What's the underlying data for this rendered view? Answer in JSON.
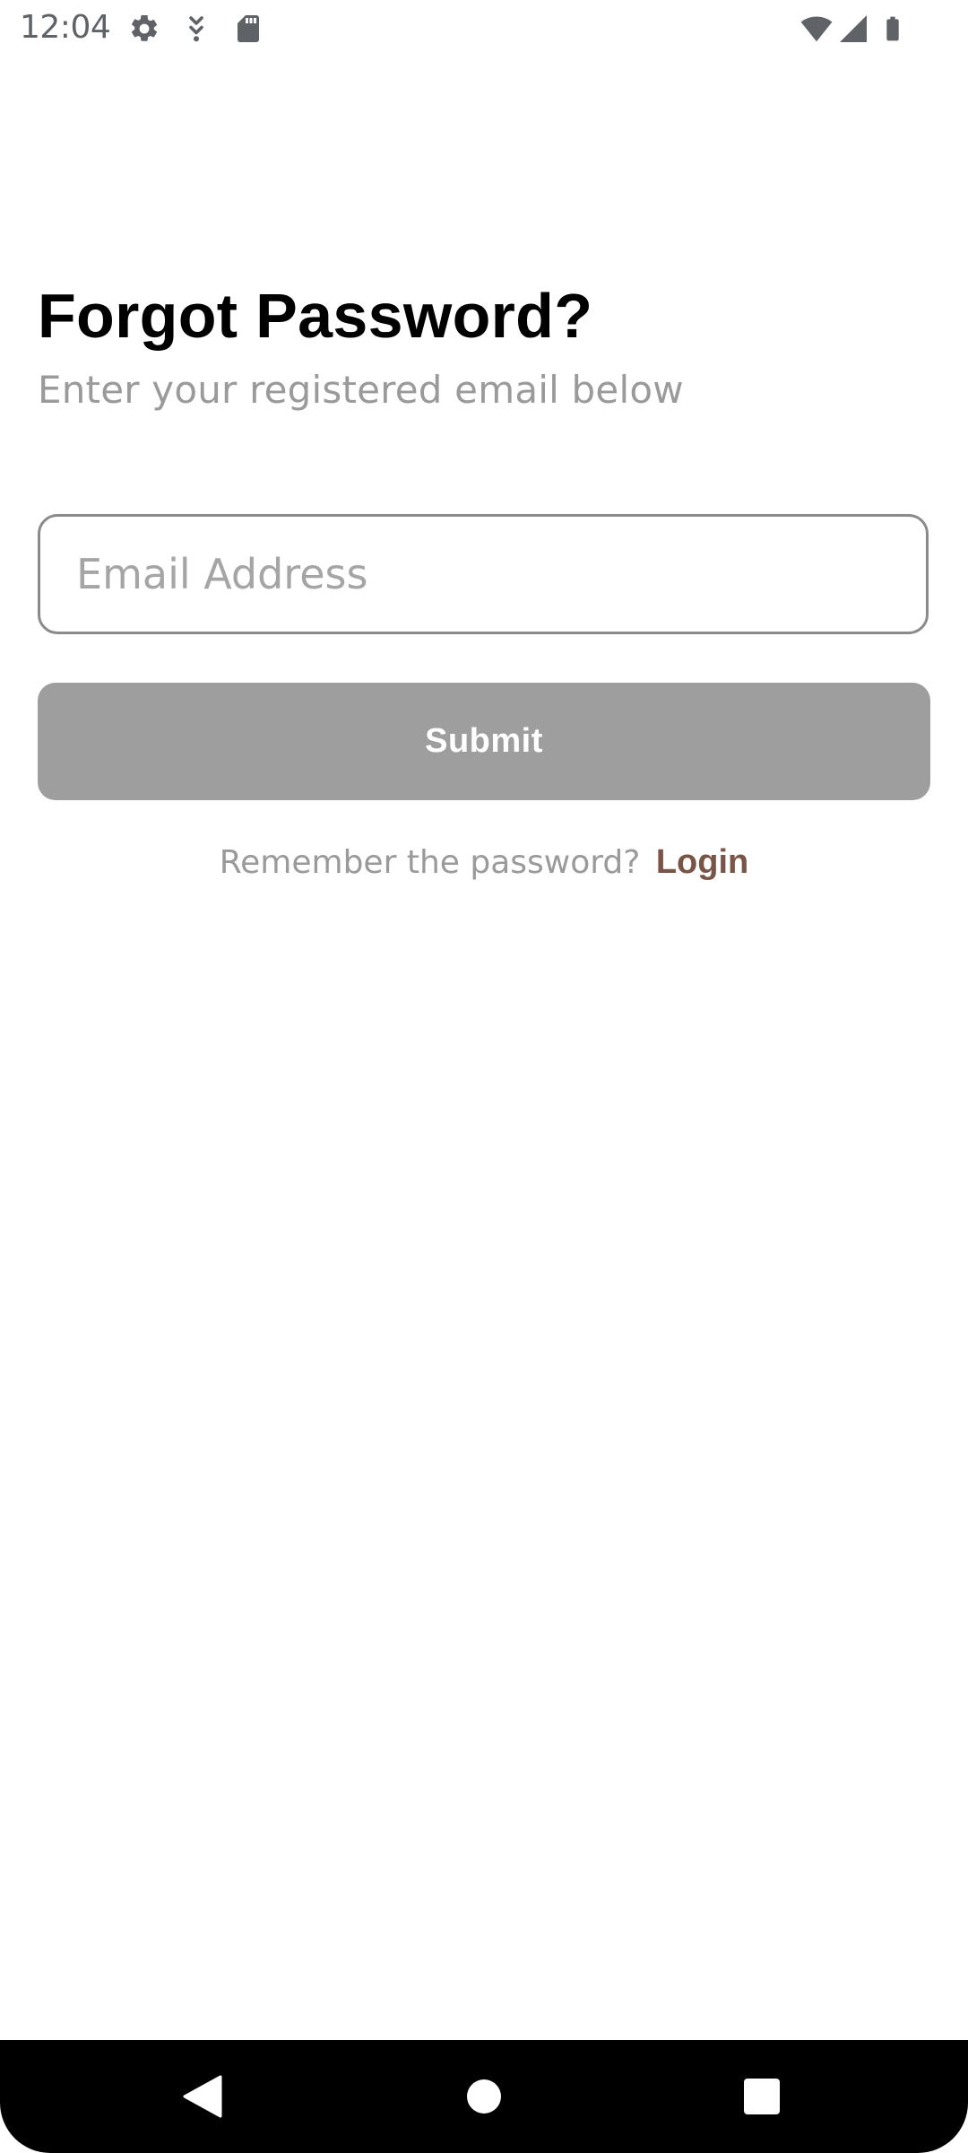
{
  "status_bar": {
    "time": "12:04",
    "icons": [
      "settings-icon",
      "download-icon",
      "sd-card-icon",
      "wifi-icon",
      "signal-icon",
      "battery-icon"
    ],
    "icon_color": "#5f6368"
  },
  "header": {
    "title": "Forgot Password?",
    "subtitle": "Enter your registered email below"
  },
  "form": {
    "email": {
      "placeholder": "Email Address",
      "value": ""
    },
    "submit_label": "Submit",
    "submit_color": "#9e9e9e"
  },
  "footer": {
    "prompt": "Remember the password?",
    "login_label": "Login",
    "login_color": "#795548"
  },
  "nav_bar": {
    "buttons": [
      "back-icon",
      "home-icon",
      "recents-icon"
    ]
  }
}
